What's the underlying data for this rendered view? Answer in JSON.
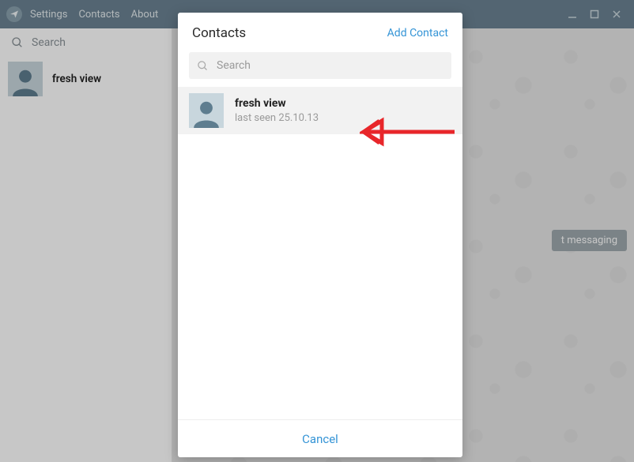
{
  "titlebar": {
    "menu": [
      "Settings",
      "Contacts",
      "About"
    ]
  },
  "left": {
    "search_placeholder": "Search",
    "chats": [
      {
        "name": "fresh view"
      }
    ]
  },
  "right": {
    "badge_partial": "t messaging"
  },
  "modal": {
    "title": "Contacts",
    "add_label": "Add Contact",
    "search_placeholder": "Search",
    "contacts": [
      {
        "name": "fresh view",
        "status": "last seen 25.10.13"
      }
    ],
    "cancel_label": "Cancel"
  },
  "colors": {
    "titlebar": "#6b8293",
    "accent": "#3494d6",
    "annotation": "#e8262a"
  }
}
